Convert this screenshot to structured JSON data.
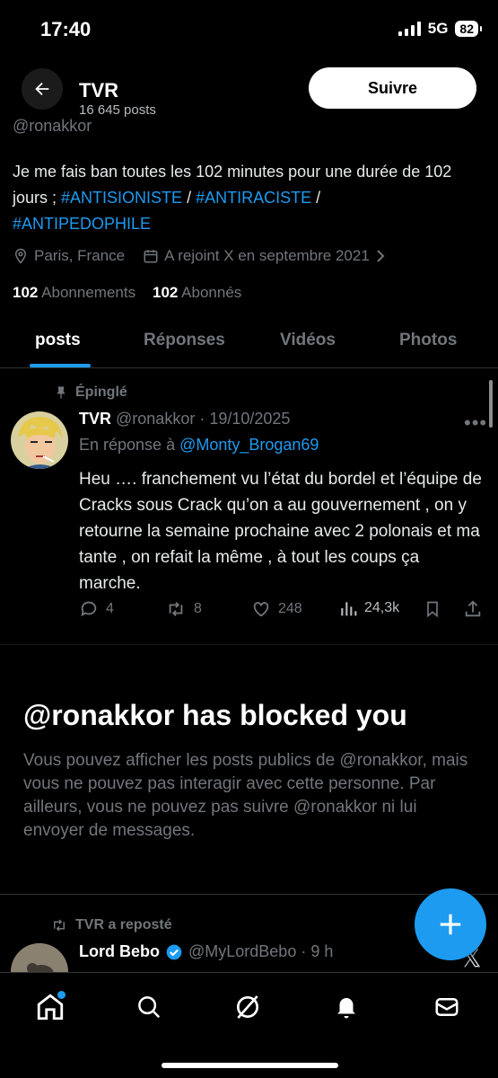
{
  "status_bar": {
    "time": "17:40",
    "network": "5G",
    "battery": "82"
  },
  "header": {
    "name": "TVR",
    "post_count": "16 645 posts",
    "follow_label": "Suivre"
  },
  "profile": {
    "handle": "@ronakkor",
    "bio_prefix": "Je me fais ban toutes les 102 minutes pour une durée de 102 jours ; ",
    "bio_tag1": "#ANTISIONISTE",
    "bio_sep1": " / ",
    "bio_tag2": "#ANTIRACISTE",
    "bio_sep2": " / ",
    "bio_tag3": "#ANTIPEDOPHILE",
    "location": "Paris, France",
    "joined": "A rejoint X en septembre 2021",
    "following_count": "102",
    "following_label": "Abonnements",
    "followers_count": "102",
    "followers_label": "Abonnés"
  },
  "tabs": {
    "posts": "posts",
    "replies": "Réponses",
    "videos": "Vidéos",
    "photos": "Photos"
  },
  "pinned_post": {
    "pinned_label": "Épinglé",
    "author": "TVR",
    "handle_date": "@ronakkor · 19/10/2025",
    "reply_prefix": "En réponse à ",
    "reply_to": "@Monty_Brogan69",
    "text": "Heu …. franchement vu l’état du bordel et l’équipe de Cracks sous Crack qu’on a au gouvernement , on y retourne la semaine prochaine avec 2 polonais et ma tante , on refait la même , à tout les coups ça marche.",
    "replies": "4",
    "reposts": "8",
    "likes": "248",
    "views": "24,3k"
  },
  "blocked": {
    "title": "@ronakkor has blocked you",
    "text": "Vous pouvez afficher les posts publics de @ronakkor, mais vous ne pouvez pas interagir avec cette personne. Par ailleurs, vous ne pouvez pas suivre @ronakkor ni lui envoyer de messages."
  },
  "repost": {
    "label": "TVR a reposté",
    "author": "Lord Bebo",
    "handle_time": "@MyLordBebo · 9 h"
  },
  "colors": {
    "accent": "#1d9bf0",
    "background": "#000000",
    "muted": "#71767b"
  }
}
